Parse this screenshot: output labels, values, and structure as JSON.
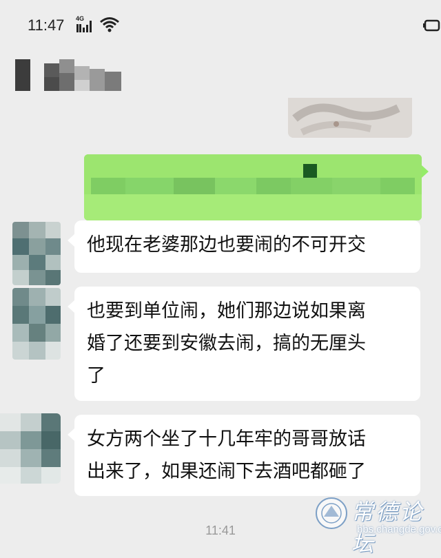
{
  "status_bar": {
    "time": "11:47",
    "signal_label": "4G",
    "icons": [
      "signal-icon",
      "wifi-icon",
      "battery-icon"
    ]
  },
  "header": {
    "contact_name": "",
    "blurred": true
  },
  "messages": [
    {
      "type": "image",
      "side": "received",
      "blurred": false
    },
    {
      "type": "text",
      "side": "sent",
      "text": "",
      "blurred": true
    },
    {
      "type": "text",
      "side": "received",
      "text": "他现在老婆那边也要闹的不可开交"
    },
    {
      "type": "text",
      "side": "received",
      "lines": [
        "也要到单位闹，她们那边说如果离",
        "婚了还要到安徽去闹，搞的无厘头",
        "了"
      ]
    },
    {
      "type": "text",
      "side": "received",
      "lines": [
        "女方两个坐了十几年牢的哥哥放话",
        "出来了，如果还闹下去酒吧都砸了"
      ]
    }
  ],
  "timestamp": "11:41",
  "watermark": {
    "title": "常德论坛",
    "url": "bbs.changde.gov.cn"
  },
  "colors": {
    "background": "#ededed",
    "sent_bubble": "#95ec69",
    "received_bubble": "#ffffff",
    "text": "#111111"
  }
}
